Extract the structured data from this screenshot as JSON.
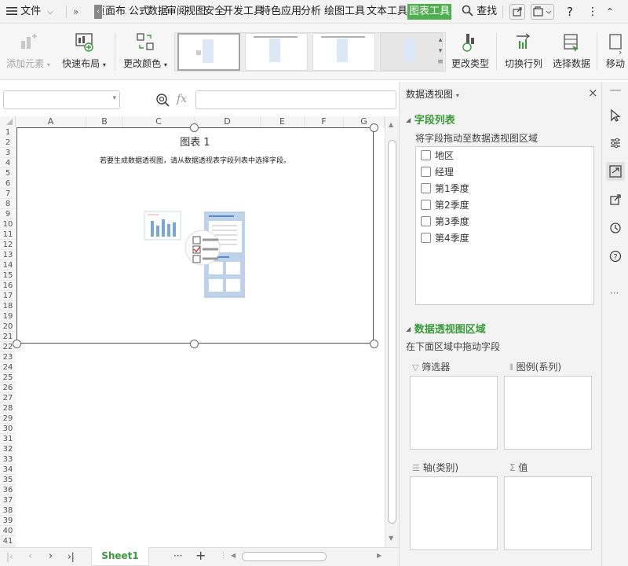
{
  "menubar": {
    "file_label": "文件",
    "tabs": [
      "页面布局",
      "公式",
      "数据",
      "审阅",
      "视图",
      "安全",
      "开发工具",
      "特色应用",
      "分析",
      "绘图工具",
      "文本工具",
      "图表工具"
    ],
    "active_tab": "图表工具",
    "search_label": "查找",
    "help_label": "?"
  },
  "ribbon": {
    "add_element": "添加元素",
    "quick_layout": "快速布局",
    "change_color": "更改颜色",
    "change_type": "更改类型",
    "switch_row_col": "切换行列",
    "select_data": "选择数据",
    "move_chart": "移动"
  },
  "formula_bar": {
    "fx_label": "fx",
    "name_box_value": "",
    "formula_value": ""
  },
  "sheet": {
    "columns": [
      "A",
      "B",
      "C",
      "D",
      "E",
      "F",
      "G"
    ],
    "rows": [
      "1",
      "2",
      "3",
      "4",
      "5",
      "6",
      "7",
      "8",
      "9",
      "10",
      "11",
      "12",
      "13",
      "14",
      "15",
      "16",
      "17",
      "18",
      "19",
      "20",
      "21",
      "22",
      "23",
      "24",
      "25",
      "26",
      "27",
      "28",
      "29",
      "30",
      "31",
      "32",
      "33",
      "34",
      "35",
      "36",
      "37",
      "38",
      "39",
      "40",
      "41"
    ],
    "tab_name": "Sheet1",
    "more_tabs": "···",
    "add_tab": "+"
  },
  "chart": {
    "title": "图表 1",
    "message": "若要生成数据透视图，请从数据透视表字段列表中选择字段。"
  },
  "panel": {
    "title": "数据透视图",
    "field_list_header": "字段列表",
    "field_list_hint": "将字段拖动至数据透视图区域",
    "fields": [
      "地区",
      "经理",
      "第1季度",
      "第2季度",
      "第3季度",
      "第4季度"
    ],
    "area_header": "数据透视图区域",
    "area_hint": "在下面区域中拖动字段",
    "zones": {
      "filter": "筛选器",
      "legend": "图例(系列)",
      "axis": "轴(类别)",
      "values": "值"
    }
  },
  "colors": {
    "accent_green": "#4caf50",
    "active_tab_bg": "#4fae4f"
  }
}
